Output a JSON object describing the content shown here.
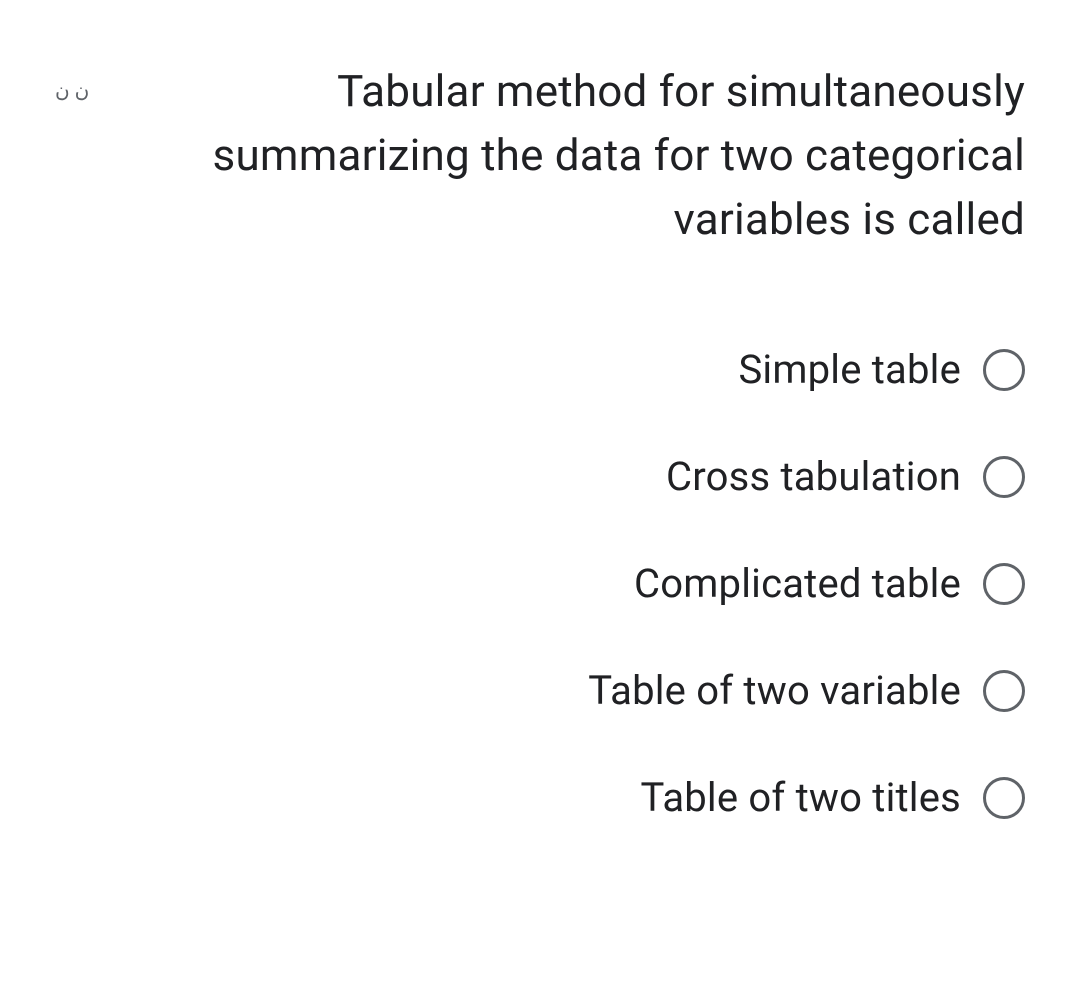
{
  "header": {
    "corner_text": "ن ن"
  },
  "question": {
    "text": "Tabular method for simultaneously summarizing the data for two categorical variables is called"
  },
  "options": [
    {
      "label": "Simple table"
    },
    {
      "label": "Cross tabulation"
    },
    {
      "label": "Complicated table"
    },
    {
      "label": "Table of two variable"
    },
    {
      "label": "Table of two titles"
    }
  ]
}
